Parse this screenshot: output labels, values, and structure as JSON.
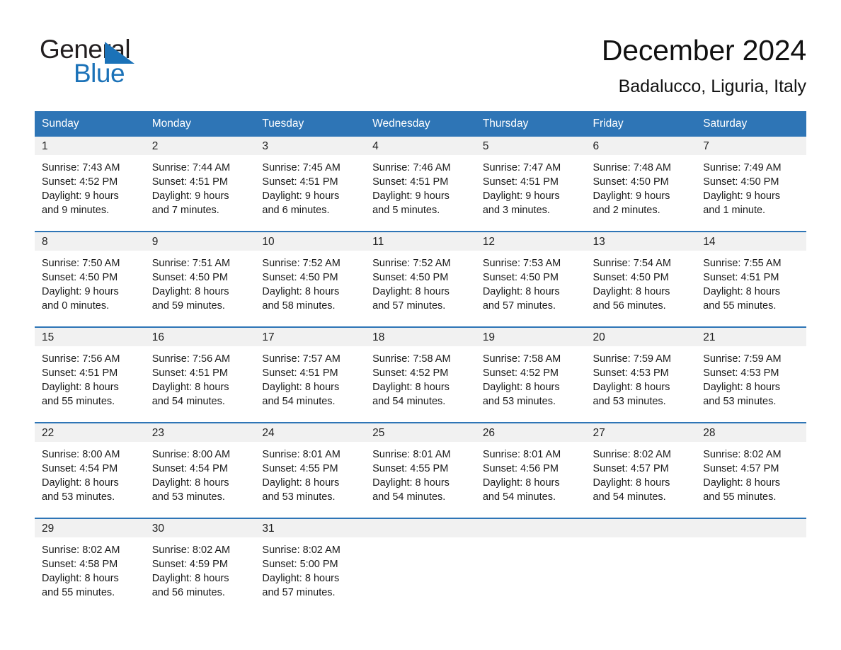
{
  "brand": {
    "logo_text_top": "General",
    "logo_text_bottom": "Blue",
    "accent_color": "#1b72b8",
    "header_color": "#2e75b6",
    "triangle_icon": "triangle-icon"
  },
  "header": {
    "title": "December 2024",
    "subtitle": "Badalucco, Liguria, Italy"
  },
  "calendar": {
    "weekdays": [
      "Sunday",
      "Monday",
      "Tuesday",
      "Wednesday",
      "Thursday",
      "Friday",
      "Saturday"
    ],
    "weeks": [
      [
        {
          "day": "1",
          "sunrise": "Sunrise: 7:43 AM",
          "sunset": "Sunset: 4:52 PM",
          "daylight_line1": "Daylight: 9 hours",
          "daylight_line2": "and 9 minutes."
        },
        {
          "day": "2",
          "sunrise": "Sunrise: 7:44 AM",
          "sunset": "Sunset: 4:51 PM",
          "daylight_line1": "Daylight: 9 hours",
          "daylight_line2": "and 7 minutes."
        },
        {
          "day": "3",
          "sunrise": "Sunrise: 7:45 AM",
          "sunset": "Sunset: 4:51 PM",
          "daylight_line1": "Daylight: 9 hours",
          "daylight_line2": "and 6 minutes."
        },
        {
          "day": "4",
          "sunrise": "Sunrise: 7:46 AM",
          "sunset": "Sunset: 4:51 PM",
          "daylight_line1": "Daylight: 9 hours",
          "daylight_line2": "and 5 minutes."
        },
        {
          "day": "5",
          "sunrise": "Sunrise: 7:47 AM",
          "sunset": "Sunset: 4:51 PM",
          "daylight_line1": "Daylight: 9 hours",
          "daylight_line2": "and 3 minutes."
        },
        {
          "day": "6",
          "sunrise": "Sunrise: 7:48 AM",
          "sunset": "Sunset: 4:50 PM",
          "daylight_line1": "Daylight: 9 hours",
          "daylight_line2": "and 2 minutes."
        },
        {
          "day": "7",
          "sunrise": "Sunrise: 7:49 AM",
          "sunset": "Sunset: 4:50 PM",
          "daylight_line1": "Daylight: 9 hours",
          "daylight_line2": "and 1 minute."
        }
      ],
      [
        {
          "day": "8",
          "sunrise": "Sunrise: 7:50 AM",
          "sunset": "Sunset: 4:50 PM",
          "daylight_line1": "Daylight: 9 hours",
          "daylight_line2": "and 0 minutes."
        },
        {
          "day": "9",
          "sunrise": "Sunrise: 7:51 AM",
          "sunset": "Sunset: 4:50 PM",
          "daylight_line1": "Daylight: 8 hours",
          "daylight_line2": "and 59 minutes."
        },
        {
          "day": "10",
          "sunrise": "Sunrise: 7:52 AM",
          "sunset": "Sunset: 4:50 PM",
          "daylight_line1": "Daylight: 8 hours",
          "daylight_line2": "and 58 minutes."
        },
        {
          "day": "11",
          "sunrise": "Sunrise: 7:52 AM",
          "sunset": "Sunset: 4:50 PM",
          "daylight_line1": "Daylight: 8 hours",
          "daylight_line2": "and 57 minutes."
        },
        {
          "day": "12",
          "sunrise": "Sunrise: 7:53 AM",
          "sunset": "Sunset: 4:50 PM",
          "daylight_line1": "Daylight: 8 hours",
          "daylight_line2": "and 57 minutes."
        },
        {
          "day": "13",
          "sunrise": "Sunrise: 7:54 AM",
          "sunset": "Sunset: 4:50 PM",
          "daylight_line1": "Daylight: 8 hours",
          "daylight_line2": "and 56 minutes."
        },
        {
          "day": "14",
          "sunrise": "Sunrise: 7:55 AM",
          "sunset": "Sunset: 4:51 PM",
          "daylight_line1": "Daylight: 8 hours",
          "daylight_line2": "and 55 minutes."
        }
      ],
      [
        {
          "day": "15",
          "sunrise": "Sunrise: 7:56 AM",
          "sunset": "Sunset: 4:51 PM",
          "daylight_line1": "Daylight: 8 hours",
          "daylight_line2": "and 55 minutes."
        },
        {
          "day": "16",
          "sunrise": "Sunrise: 7:56 AM",
          "sunset": "Sunset: 4:51 PM",
          "daylight_line1": "Daylight: 8 hours",
          "daylight_line2": "and 54 minutes."
        },
        {
          "day": "17",
          "sunrise": "Sunrise: 7:57 AM",
          "sunset": "Sunset: 4:51 PM",
          "daylight_line1": "Daylight: 8 hours",
          "daylight_line2": "and 54 minutes."
        },
        {
          "day": "18",
          "sunrise": "Sunrise: 7:58 AM",
          "sunset": "Sunset: 4:52 PM",
          "daylight_line1": "Daylight: 8 hours",
          "daylight_line2": "and 54 minutes."
        },
        {
          "day": "19",
          "sunrise": "Sunrise: 7:58 AM",
          "sunset": "Sunset: 4:52 PM",
          "daylight_line1": "Daylight: 8 hours",
          "daylight_line2": "and 53 minutes."
        },
        {
          "day": "20",
          "sunrise": "Sunrise: 7:59 AM",
          "sunset": "Sunset: 4:53 PM",
          "daylight_line1": "Daylight: 8 hours",
          "daylight_line2": "and 53 minutes."
        },
        {
          "day": "21",
          "sunrise": "Sunrise: 7:59 AM",
          "sunset": "Sunset: 4:53 PM",
          "daylight_line1": "Daylight: 8 hours",
          "daylight_line2": "and 53 minutes."
        }
      ],
      [
        {
          "day": "22",
          "sunrise": "Sunrise: 8:00 AM",
          "sunset": "Sunset: 4:54 PM",
          "daylight_line1": "Daylight: 8 hours",
          "daylight_line2": "and 53 minutes."
        },
        {
          "day": "23",
          "sunrise": "Sunrise: 8:00 AM",
          "sunset": "Sunset: 4:54 PM",
          "daylight_line1": "Daylight: 8 hours",
          "daylight_line2": "and 53 minutes."
        },
        {
          "day": "24",
          "sunrise": "Sunrise: 8:01 AM",
          "sunset": "Sunset: 4:55 PM",
          "daylight_line1": "Daylight: 8 hours",
          "daylight_line2": "and 53 minutes."
        },
        {
          "day": "25",
          "sunrise": "Sunrise: 8:01 AM",
          "sunset": "Sunset: 4:55 PM",
          "daylight_line1": "Daylight: 8 hours",
          "daylight_line2": "and 54 minutes."
        },
        {
          "day": "26",
          "sunrise": "Sunrise: 8:01 AM",
          "sunset": "Sunset: 4:56 PM",
          "daylight_line1": "Daylight: 8 hours",
          "daylight_line2": "and 54 minutes."
        },
        {
          "day": "27",
          "sunrise": "Sunrise: 8:02 AM",
          "sunset": "Sunset: 4:57 PM",
          "daylight_line1": "Daylight: 8 hours",
          "daylight_line2": "and 54 minutes."
        },
        {
          "day": "28",
          "sunrise": "Sunrise: 8:02 AM",
          "sunset": "Sunset: 4:57 PM",
          "daylight_line1": "Daylight: 8 hours",
          "daylight_line2": "and 55 minutes."
        }
      ],
      [
        {
          "day": "29",
          "sunrise": "Sunrise: 8:02 AM",
          "sunset": "Sunset: 4:58 PM",
          "daylight_line1": "Daylight: 8 hours",
          "daylight_line2": "and 55 minutes."
        },
        {
          "day": "30",
          "sunrise": "Sunrise: 8:02 AM",
          "sunset": "Sunset: 4:59 PM",
          "daylight_line1": "Daylight: 8 hours",
          "daylight_line2": "and 56 minutes."
        },
        {
          "day": "31",
          "sunrise": "Sunrise: 8:02 AM",
          "sunset": "Sunset: 5:00 PM",
          "daylight_line1": "Daylight: 8 hours",
          "daylight_line2": "and 57 minutes."
        },
        {
          "day": "",
          "sunrise": "",
          "sunset": "",
          "daylight_line1": "",
          "daylight_line2": ""
        },
        {
          "day": "",
          "sunrise": "",
          "sunset": "",
          "daylight_line1": "",
          "daylight_line2": ""
        },
        {
          "day": "",
          "sunrise": "",
          "sunset": "",
          "daylight_line1": "",
          "daylight_line2": ""
        },
        {
          "day": "",
          "sunrise": "",
          "sunset": "",
          "daylight_line1": "",
          "daylight_line2": ""
        }
      ]
    ]
  }
}
